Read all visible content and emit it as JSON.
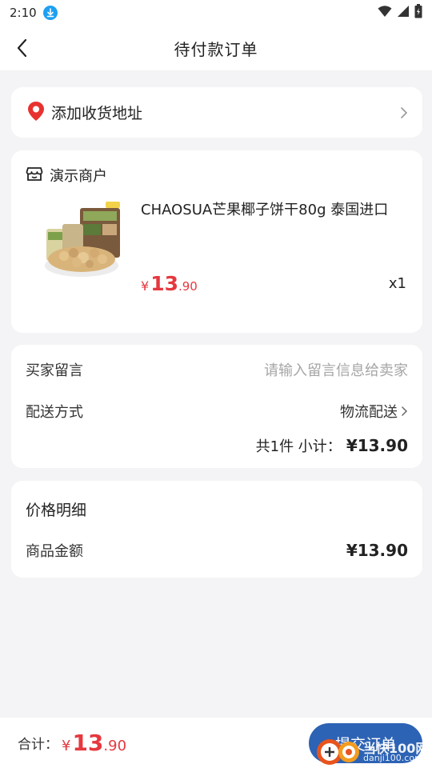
{
  "status_bar": {
    "time": "2:10"
  },
  "nav": {
    "title": "待付款订单"
  },
  "address": {
    "label": "添加收货地址"
  },
  "shop": {
    "name": "演示商户",
    "product": {
      "title": "CHAOSUA芒果椰子饼干80g 泰国进口",
      "price_symbol": "¥",
      "price_int": "13",
      "price_dec": ".90",
      "quantity": "x1"
    }
  },
  "order": {
    "message_label": "买家留言",
    "message_placeholder": "请输入留言信息给卖家",
    "delivery_label": "配送方式",
    "delivery_value": "物流配送",
    "subtotal_prefix": "共1件 小计：",
    "subtotal_amount": "¥13.90"
  },
  "price_detail": {
    "heading": "价格明细",
    "goods_label": "商品金额",
    "goods_amount": "¥13.90"
  },
  "bottom": {
    "total_label": "合计：",
    "total_symbol": "¥",
    "total_int": "13",
    "total_dec": ".90",
    "submit_label": "提交订单"
  },
  "watermark": {
    "text": "当快100网",
    "url": "danji100.com"
  },
  "colors": {
    "accent": "#e5383f",
    "button": "#2d63b4",
    "location": "#e8322f",
    "download": "#1ea0f2"
  }
}
